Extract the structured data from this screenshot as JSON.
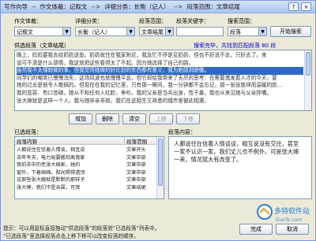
{
  "window": {
    "title": "写作向导",
    "crumb_sep1": "--",
    "genre_label": "作文体裁：",
    "genre_value": "记叙文",
    "crumb_sep2": "-->",
    "detail_label": "详细分类：",
    "detail_value": "长衡（记人）",
    "crumb_sep3": "-->",
    "range_label": "段落范围：",
    "range_value": "文章结尾",
    "help_btn": "?",
    "close_btn": "×"
  },
  "filters": {
    "genre": {
      "label": "作文体裁：",
      "value": "记叙文"
    },
    "detail": {
      "label": "详细分类：",
      "value": "长衡（记人）"
    },
    "range": {
      "label": "段落范围：",
      "value": "文章结尾"
    },
    "keyword": {
      "label": "段落关键字：",
      "value": ""
    },
    "search_range": {
      "label": "搜索范围：",
      "value": "段落"
    },
    "search_btn": "开始搜索"
  },
  "selectable": {
    "label": "供选段落（文章结尾）",
    "status": "搜索完毕，共找到匹配段落 80 段",
    "lines": [
      "晚上，妈妈要我去给奶奶送鱼。奶奶就住在我家附近，我急忙不停是见奶奶，但也不好说不去，只好去了。来",
      "说可不清是什么感情，我这就把这些看得太了不起。因为她选择了自己的路。",
      "虽然我不太懂她做的事，但我觉得她做的好比别的东西都有意义，我为她感到骄傲。",
      "同学们的嘲笑已慢慢消失，这场风波也就慢慢平息，但它却给我带来了无尽的思考：在需要激发着人才的今天，要",
      "她的过去是很令人敬佩的。但现在在我的记忆里，只有那一瞬间，我一分钟都不会忘记，那一张张慈祥而温暖的脸…",
      "我的宽容、有口皆碑。她从不和任何人红脸，争吵。我的父亲是当兵出身，性子暴，我也从来见她与父亲拌嘴。",
      "张大婶就是这样一个人。我与她非亲非故，我们在这陌生又熟悉的城市里彼此相遇，"
    ],
    "highlight_index": 2
  },
  "actions": {
    "add": "增加",
    "remove": "删除",
    "clear": "清空",
    "up": "上移",
    "down": "下移"
  },
  "selected": {
    "label": "已选段落：",
    "col_content": "段落内容",
    "col_range": "段落范围",
    "rows": [
      {
        "content": "人都说住在信着人情谈，相互说",
        "range": "文章开头"
      },
      {
        "content": "去年冬天，电力局要搬到离我家",
        "range": "文章中部"
      },
      {
        "content": "我前去中的老张大姆家，她的",
        "range": "文章中部"
      },
      {
        "content": "窗外，下着绵绵。阳光照得透顶",
        "range": "文章中部"
      },
      {
        "content": "这那些张大嫂就是默默的那样子",
        "range": "文章中部"
      },
      {
        "content": "张大婶，我们不是亲属，可我",
        "range": "文章结尾"
      }
    ]
  },
  "content": {
    "label": "段落内容：",
    "text": "人都说住在信着人情谈谈，相互说没有交往，甚至一家不认识一家。我们丈儿也不例外。可是张大婶一来，情况就大有改变了。"
  },
  "footer": {
    "hint1": "提示：可以用鼠标直接拖动“供选段落”的段落到“已选段落”列表中。",
    "hint2": "“已选段落”里选择段落点击上移下移可以改变段落的顺序。",
    "done": "完成",
    "cancel": "取消",
    "logo_text": "多特软件站",
    "logo_url": "DuoTe.com"
  },
  "colors": {
    "accent": "#316ac5",
    "title_grad_top": "#d6e4fb",
    "title_grad_bottom": "#a9c4f0",
    "status_blue": "#0000cc"
  }
}
